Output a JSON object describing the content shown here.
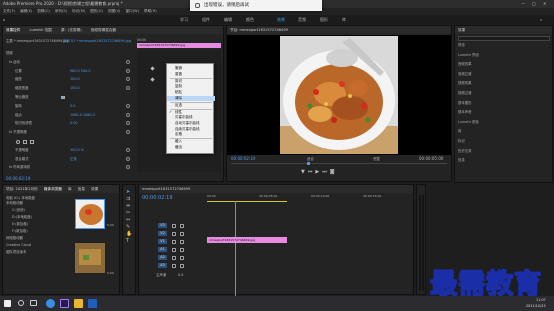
{
  "app": {
    "title": "Adobe Premiere Pro 2020 - D:\\视频\\剪辑工程\\最需教育.prproj *",
    "menus": [
      "文件(F)",
      "编辑(E)",
      "剪辑(C)",
      "序列(S)",
      "标记(M)",
      "图形(G)",
      "视图(V)",
      "窗口(W)",
      "帮助(H)"
    ],
    "toast": "出现错误，请稍后再试"
  },
  "workspaces": [
    "学习",
    "组件",
    "编辑",
    "颜色",
    "效果",
    "音频",
    "图形",
    "库"
  ],
  "effect_controls": {
    "tabs": [
      "效果控件",
      "Lumetri 范围",
      "源：(无剪辑)",
      "音频剪辑混合器"
    ],
    "source": "主要 * mmexport1631572746499.jpg",
    "seq": "序列 01 * mmexport1631572746499.jpg",
    "clip_label": "mmexport1631572746499.jpg",
    "time_start": "00:00",
    "rows": [
      {
        "label": "视频",
        "value": "",
        "type": "section"
      },
      {
        "label": "fx 运动",
        "value": "",
        "type": "group"
      },
      {
        "label": "位置",
        "value": "960.0    540.0",
        "type": "prop"
      },
      {
        "label": "缩放",
        "value": "100.0",
        "type": "prop"
      },
      {
        "label": "缩放宽度",
        "value": "100.0",
        "type": "prop"
      },
      {
        "label": "等比缩放",
        "value": "",
        "type": "check"
      },
      {
        "label": "旋转",
        "value": "0.0",
        "type": "prop"
      },
      {
        "label": "锚点",
        "value": "1080.0   1080.0",
        "type": "prop"
      },
      {
        "label": "防闪烁滤镜",
        "value": "0.00",
        "type": "prop"
      },
      {
        "label": "fx 不透明度",
        "value": "",
        "type": "group"
      },
      {
        "label": "",
        "value": "",
        "type": "masks"
      },
      {
        "label": "不透明度",
        "value": "100.0 %",
        "type": "prop"
      },
      {
        "label": "混合模式",
        "value": "正常",
        "type": "prop"
      },
      {
        "label": "fx 时间重映射",
        "value": "",
        "type": "group"
      }
    ],
    "timecode": "00:00:02:19"
  },
  "context_menu": {
    "items": [
      {
        "label": "撤销",
        "sep": false,
        "hl": false,
        "checked": false
      },
      {
        "label": "重做",
        "sep": false,
        "hl": false,
        "checked": false
      },
      {
        "label": "剪切",
        "sep": true,
        "hl": false,
        "checked": false
      },
      {
        "label": "复制",
        "sep": false,
        "hl": false,
        "checked": false
      },
      {
        "label": "粘贴",
        "sep": false,
        "hl": false,
        "checked": false
      },
      {
        "label": "清除",
        "sep": false,
        "hl": true,
        "checked": false
      },
      {
        "label": "反选",
        "sep": true,
        "hl": false,
        "checked": false
      },
      {
        "label": "线性",
        "sep": true,
        "hl": false,
        "checked": true
      },
      {
        "label": "贝塞尔曲线",
        "sep": false,
        "hl": false,
        "checked": false
      },
      {
        "label": "自动贝塞尔曲线",
        "sep": false,
        "hl": false,
        "checked": false
      },
      {
        "label": "连续贝塞尔曲线",
        "sep": false,
        "hl": false,
        "checked": false
      },
      {
        "label": "定格",
        "sep": false,
        "hl": false,
        "checked": false
      },
      {
        "label": "缓入",
        "sep": true,
        "hl": false,
        "checked": false
      },
      {
        "label": "缓出",
        "sep": false,
        "hl": false,
        "checked": false
      }
    ]
  },
  "program": {
    "header": "节目: mmexport1631572746499",
    "timecode_left": "00:00:02:19",
    "fit": "适合",
    "quality": "完整",
    "timecode_right": "00:00:05:00"
  },
  "project": {
    "tabs": [
      "项目: 2021年2月份",
      "媒体浏览器",
      "库",
      "信息",
      "效果"
    ],
    "tree_header": "电脑 (D:) 本地磁盘",
    "tree": [
      "本地驱动器",
      "C:(系统)",
      "D:(本地磁盘)",
      "E:(新加卷)",
      "F:(新加卷)",
      "网络驱动器",
      "Creative Cloud",
      "团队项目版本"
    ],
    "thumbs": [
      {
        "dur": "5:00"
      },
      {
        "dur": "5:00"
      }
    ]
  },
  "timeline": {
    "tab": "mmexport1631572746499",
    "timecode": "00:00:02:19",
    "ruler": [
      "00:00",
      "00:00:05:00",
      "00:00:10:00",
      "00:00:15:00"
    ],
    "tracks": [
      "V3",
      "V2",
      "V1",
      "A1",
      "A2",
      "A3"
    ],
    "master": "主声道",
    "master_val": "0.0",
    "clip_label": "mmexport1631572746499.jpg"
  },
  "right_panel": {
    "header": "效果",
    "items": [
      "预设",
      "Lumetri 预设",
      "音频效果",
      "音频过渡",
      "视频效果",
      "视频过渡",
      "基本图形",
      "基本声音",
      "Lumetri 颜色",
      "库",
      "标记",
      "历史记录",
      "信息"
    ]
  },
  "taskbar": {
    "time": "11:07",
    "date": "2021/10/23"
  },
  "watermark": "最需教育",
  "colors": {
    "clip_pink": "#e58ce0",
    "accent_blue": "#2d8ceb",
    "playhead": "#4d9bea"
  }
}
